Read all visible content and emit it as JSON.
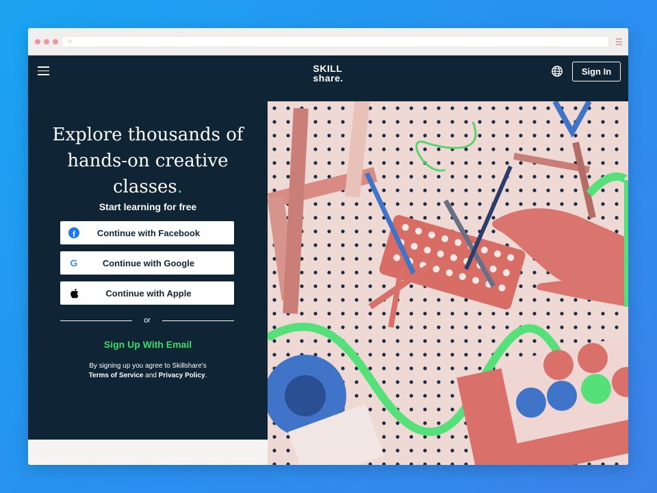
{
  "site": {
    "logo_line1": "SKILL",
    "logo_line2": "share.",
    "signin_label": "Sign In"
  },
  "signup": {
    "headline_line1": "Explore thousands of",
    "headline_line2": "hands-on creative",
    "headline_line3": "classes",
    "headline_dot": ".",
    "subhead": "Start learning for free",
    "sso_buttons": [
      {
        "label": "Continue with Facebook",
        "icon": "facebook-icon"
      },
      {
        "label": "Continue with Google",
        "icon": "google-icon"
      },
      {
        "label": "Continue with Apple",
        "icon": "apple-icon"
      }
    ],
    "divider_text": "or",
    "email_link": "Sign Up With Email",
    "legal_prefix": "By signing up you agree to Skillshare's",
    "legal_terms": "Terms of Service",
    "legal_and": " and ",
    "legal_privacy": "Privacy Policy",
    "legal_suffix": "."
  },
  "colors": {
    "background_gradient_start": "#1aa4f2",
    "background_gradient_end": "#3b82e8",
    "navy": "#0f2435",
    "accent_green": "#38de66",
    "hero_pink": "#d9726b",
    "hero_blue": "#3f74c9"
  },
  "hero_image": {
    "description_icon": "craft-pegboard-illustration"
  }
}
